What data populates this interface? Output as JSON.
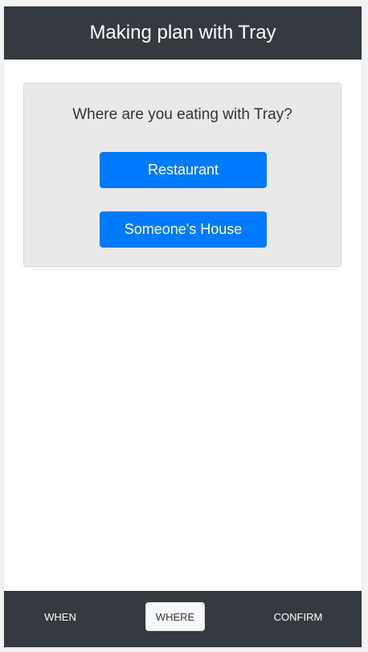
{
  "header": {
    "title": "Making plan with Tray"
  },
  "card": {
    "question": "Where are you eating with Tray?",
    "options": [
      {
        "label": "Restaurant"
      },
      {
        "label": "Someone's House"
      }
    ]
  },
  "nav": {
    "items": [
      {
        "label": "WHEN",
        "active": false
      },
      {
        "label": "WHERE",
        "active": true
      },
      {
        "label": "CONFIRM",
        "active": false
      }
    ]
  },
  "colors": {
    "header_bg": "#343a40",
    "primary": "#007bff",
    "card_bg": "#e9e9e9",
    "active_tab_bg": "#f8f9fa"
  }
}
